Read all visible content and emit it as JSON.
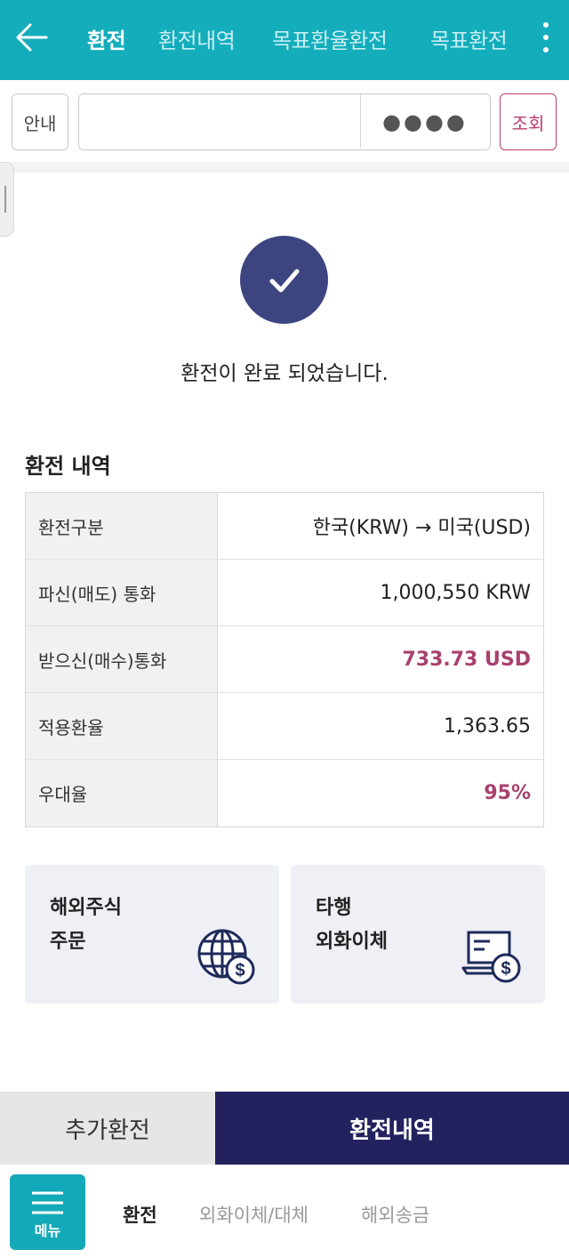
{
  "header": {
    "tabs": [
      {
        "label": "환전",
        "active": true
      },
      {
        "label": "환전내역",
        "active": false
      },
      {
        "label": "목표환율환전",
        "active": false
      },
      {
        "label": "목표환전",
        "active": false
      }
    ],
    "color": "#14adbc"
  },
  "account_bar": {
    "guide_label": "안내",
    "password_mask": "●●●●",
    "query_label": "조회"
  },
  "result": {
    "message": "환전이 완료 되었습니다.",
    "icon": "check-icon"
  },
  "details": {
    "title": "환전 내역",
    "rows": [
      {
        "label": "환전구분",
        "value": "한국(KRW) → 미국(USD)"
      },
      {
        "label": "파신(매도) 통화",
        "value": "1,000,550 KRW"
      },
      {
        "label": "받으신(매수)통화",
        "value": "733.73 USD"
      },
      {
        "label": "적용환율",
        "value": "1,363.65"
      },
      {
        "label": "우대율",
        "value": "95%"
      }
    ],
    "accent_color": "#a8416f"
  },
  "cards": [
    {
      "line1": "해외주식",
      "line2": "주문",
      "icon": "globe-dollar-icon"
    },
    {
      "line1": "타행",
      "line2": "외화이체",
      "icon": "laptop-dollar-icon"
    }
  ],
  "actions": {
    "secondary": "추가환전",
    "primary": "환전내역",
    "primary_color": "#23225f"
  },
  "bottom_nav": {
    "menu_label": "메뉴",
    "items": [
      {
        "label": "환전",
        "active": true
      },
      {
        "label": "외화이체/대체",
        "active": false
      },
      {
        "label": "해외송금",
        "active": false
      }
    ]
  }
}
